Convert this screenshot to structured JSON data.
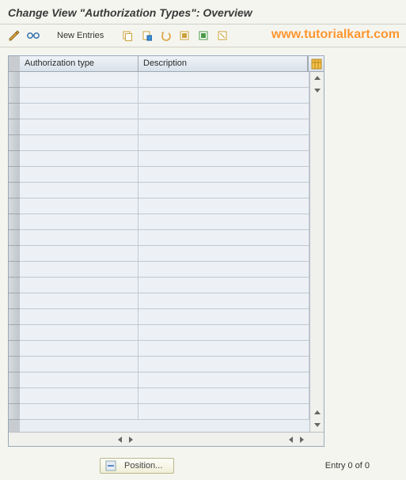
{
  "title": "Change View \"Authorization Types\": Overview",
  "watermark": "www.tutorialkart.com",
  "toolbar": {
    "new_entries_label": "New Entries"
  },
  "table": {
    "columns": {
      "auth_type": "Authorization type",
      "description": "Description"
    },
    "row_count": 22
  },
  "footer": {
    "position_label": "Position...",
    "entry_text": "Entry 0 of 0"
  }
}
